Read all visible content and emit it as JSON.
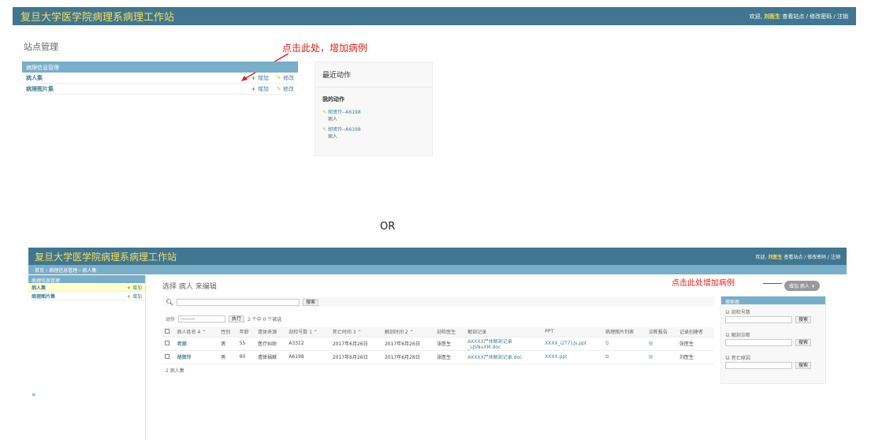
{
  "top": {
    "brand": "复旦大学医学院病理系病理工作站",
    "welcome": "欢迎,",
    "user": "刘医生",
    "links": "查看站点 / 修改密码 / 注销",
    "site_title": "站点管理",
    "annotation": "点击此处，增加病例",
    "module_caption": "病理信息管理",
    "rows": [
      {
        "name": "病人集",
        "add": "增加",
        "change": "修改"
      },
      {
        "name": "病理图片集",
        "add": "增加",
        "change": "修改"
      }
    ],
    "recent": {
      "title": "最近动作",
      "mine": "我的动作",
      "items": [
        {
          "link": "胡贤玲--A6198",
          "type": "病人"
        },
        {
          "link": "胡贤玲--A6198",
          "type": "病人"
        }
      ]
    }
  },
  "or_text": "OR",
  "bottom": {
    "brand": "复旦大学医学院病理系病理工作站",
    "welcome": "欢迎,",
    "user": "刘医生",
    "links": "查看站点 / 修改密码 / 注销",
    "breadcrumb": "首页 › 病理信息管理 › 病人集",
    "side_caption": "病理信息管理",
    "side_rows": [
      {
        "name": "病人集",
        "add": "增加"
      },
      {
        "name": "病理图片集",
        "add": "增加"
      }
    ],
    "collapse": "«",
    "title": "选择 病人 来编辑",
    "add_button": "增加 病人",
    "annotation": "点击此处增加病例",
    "search_button": "搜索",
    "action_label": "动作",
    "action_select": "--------",
    "go_button": "执行",
    "selected": "2 个中 0 个被选",
    "columns": [
      "病人姓名 4 ⌃",
      "性别",
      "年龄",
      "遗体来源",
      "剖检号数 1 ⌃",
      "死亡时间 3 ⌃",
      "解剖时间 2 ⌃",
      "剖检医生",
      "解剖记录",
      "PPT",
      "病理图片列表",
      "诊断报告",
      "记录创建者"
    ],
    "rows": [
      {
        "name": "老胡",
        "sex": "男",
        "age": "55",
        "source": "医疗纠纷",
        "id": "A3312",
        "death": "2017年6月26日",
        "autopsy": "2017年6月26日",
        "doctor": "张医生",
        "record": "AXXXX尸体解剖记录\n_LJSNuXM.doc",
        "ppt": "XXXX_i2T71Js.ppt",
        "creator": "张医生"
      },
      {
        "name": "胡贤玲",
        "sex": "男",
        "age": "60",
        "source": "遗体捐献",
        "id": "A6198",
        "death": "2017年6月26日",
        "autopsy": "2017年6月28日",
        "doctor": "张医生",
        "record": "AXXXX尸体解剖记录.doc",
        "ppt": "XXXX.ppt",
        "creator": "刘医生"
      }
    ],
    "count": "2 病人集",
    "filter": {
      "caption": "搜索器",
      "groups": [
        {
          "label": "以 剖检号数",
          "button": "搜索"
        },
        {
          "label": "以 解剖诊断",
          "button": "搜索"
        },
        {
          "label": "以 死亡原因",
          "button": "搜索"
        }
      ]
    }
  }
}
